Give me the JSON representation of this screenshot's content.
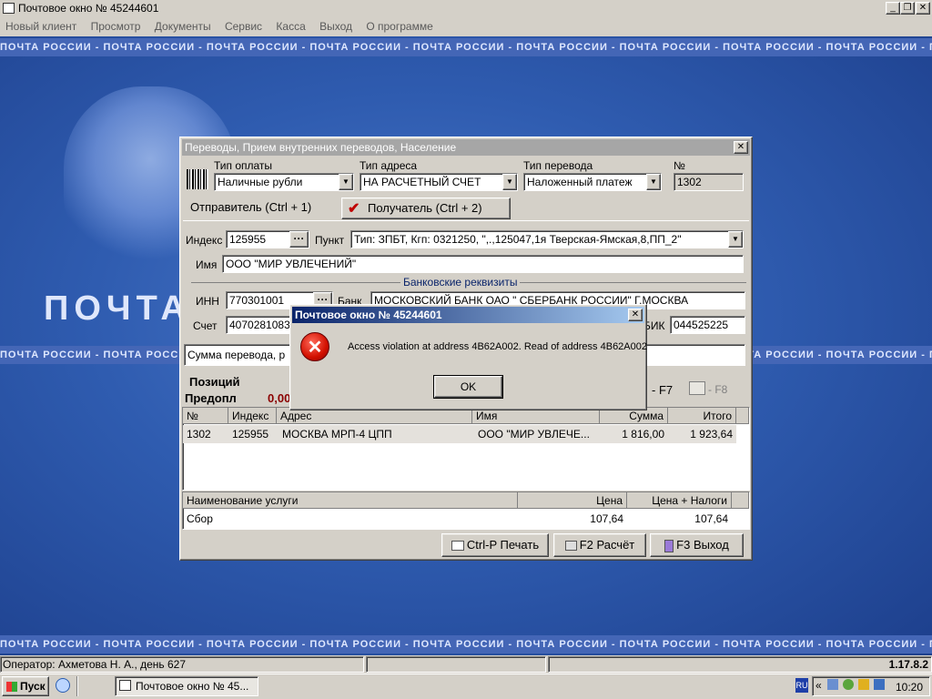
{
  "app": {
    "title": "Почтовое окно № 45244601",
    "menu": [
      "Новый клиент",
      "Просмотр",
      "Документы",
      "Сервис",
      "Касса",
      "Выход",
      "О программе"
    ]
  },
  "background": {
    "ribbon_text": "ПОЧТА РОССИИ - ПОЧТА РОССИИ - ПОЧТА РОССИИ - ПОЧТА РОССИИ - ПОЧТА РОССИИ - ПОЧТА РОССИИ - ПОЧТА РОССИИ - ПОЧТА РОССИИ - ПОЧТА РОССИИ - ПОЧТА РОССИИ",
    "logo_text": "ПОЧТА РО"
  },
  "form": {
    "title": "Переводы, Прием внутренних переводов, Население",
    "payment_type_label": "Тип оплаты",
    "payment_type_value": "Наличные рубли",
    "address_type_label": "Тип адреса",
    "address_type_value": "НА РАСЧЕТНЫЙ СЧЕТ",
    "transfer_type_label": "Тип перевода",
    "transfer_type_value": "Наложенный платеж",
    "number_label": "№",
    "number_value": "1302",
    "tab_sender": "Отправитель (Ctrl + 1)",
    "tab_recipient": "Получатель (Ctrl + 2)",
    "index_label": "Индекс",
    "index_value": "125955",
    "punkt_label": "Пункт",
    "punkt_value": "Тип: ЗПБТ, Кгп: 0321250, \",.,125047,1я Тверская-Ямская,8,ПП_2\"",
    "name_label": "Имя",
    "name_value": "ООО \"МИР УВЛЕЧЕНИЙ\"",
    "bank_section": "Банковские реквизиты",
    "inn_label": "ИНН",
    "inn_value": "770301001",
    "bank_label": "Банк",
    "bank_value": "МОСКОВСКИЙ БАНК ОАО \" СБЕРБАНК РОССИИ\" Г.МОСКВА",
    "account_label": "Счет",
    "account_value": "4070281083",
    "bik_label": "БИК",
    "bik_value": "044525225",
    "sum_label": "Сумма перевода, р",
    "positions_label": "Позиций",
    "prepay_label": "Предопл",
    "prepay_value": "0,00",
    "f7_label": "- F7",
    "f8_label": "- F8",
    "grid_headers": [
      "№",
      "Индекс",
      "Адрес",
      "Имя",
      "Сумма",
      "Итого"
    ],
    "grid_rows": [
      [
        "1302",
        "125955",
        "МОСКВА МРП-4 ЦПП",
        "ООО \"МИР УВЛЕЧЕ...",
        "1 816,00",
        "1 923,64"
      ]
    ],
    "service_headers": [
      "Наименование услуги",
      "Цена",
      "Цена + Налоги"
    ],
    "service_rows": [
      [
        "Сбор",
        "107,64",
        "107,64"
      ]
    ],
    "btn_print": "Ctrl-P  Печать",
    "btn_calc": "F2  Расчёт",
    "btn_exit": "F3  Выход"
  },
  "dialog": {
    "title": "Почтовое окно № 45244601",
    "message": "Access violation at address 4B62A002. Read of address 4B62A002",
    "ok": "OK"
  },
  "status": {
    "operator": "Оператор: Ахметова Н. А., день 627",
    "version": "1.17.8.2"
  },
  "taskbar": {
    "start": "Пуск",
    "task": "Почтовое окно № 45...",
    "lang": "RU",
    "time": "10:20"
  }
}
